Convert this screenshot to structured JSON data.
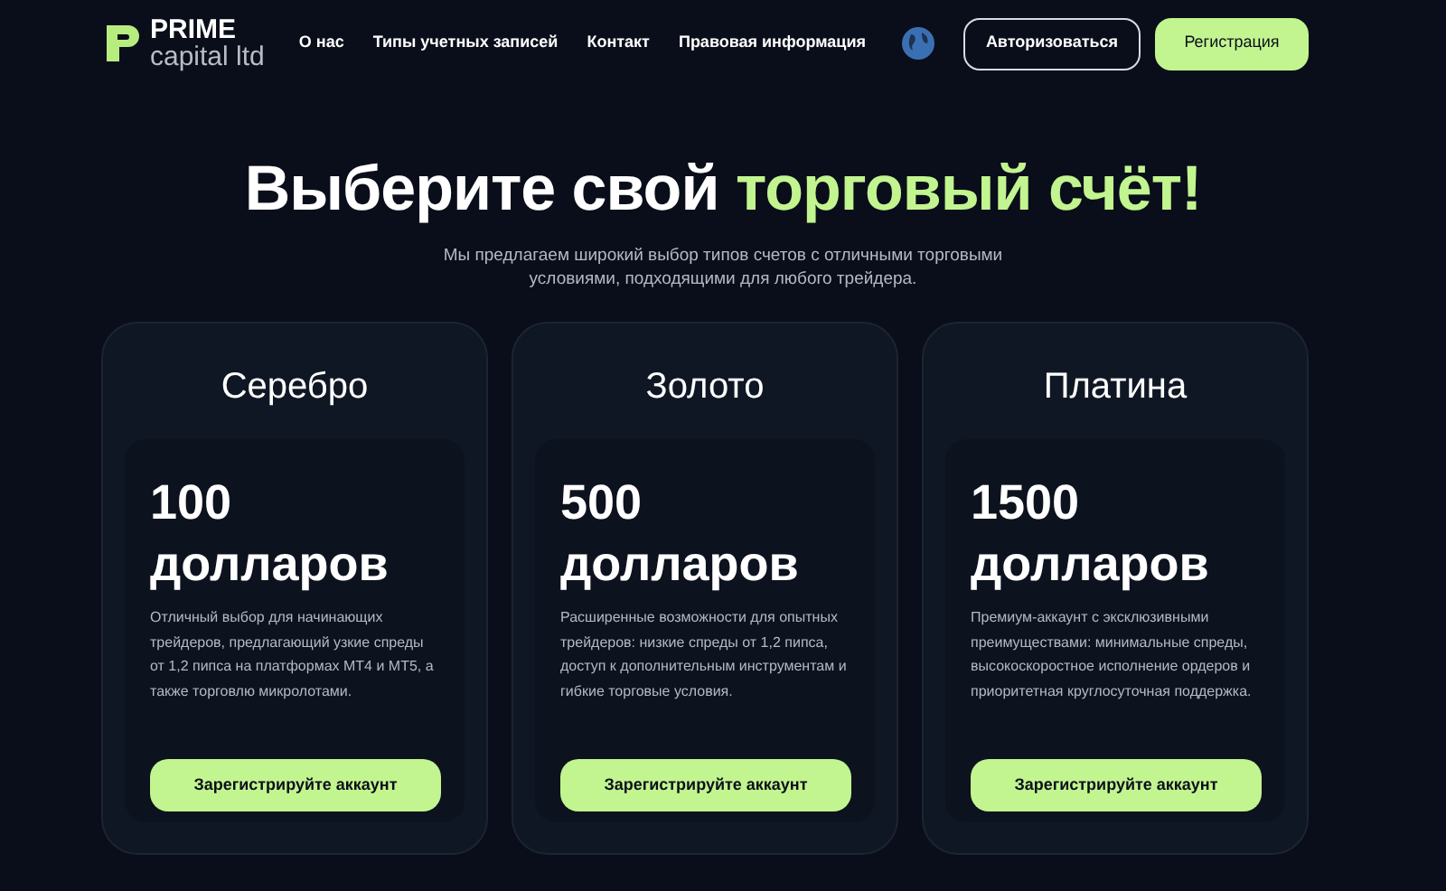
{
  "header": {
    "logo": {
      "name": "PRIME",
      "subtitle": "capital ltd"
    },
    "nav": [
      {
        "label": "О нас"
      },
      {
        "label": "Типы учетных записей"
      },
      {
        "label": "Контакт"
      },
      {
        "label": "Правовая информация"
      }
    ],
    "login_button": "Авторизоваться",
    "register_button": "Регистрация"
  },
  "hero": {
    "title": "Выберите свой",
    "title_accent": "торговый счёт!",
    "subtitle": "Мы предлагаем широкий выбор типов счетов с отличными торговыми условиями, подходящими для любого трейдера."
  },
  "plans": [
    {
      "name": "Серебро",
      "amount": "100",
      "currency": "долларов",
      "description": "Отличный выбор для начинающих трейдеров, предлагающий узкие спреды от 1,2 пипса на платформах MT4 и MT5, а также торговлю микролотами.",
      "button": "Зарегистрируйте аккаунт"
    },
    {
      "name": "Золото",
      "amount": "500",
      "currency": "долларов",
      "description": "Расширенные возможности для опытных трейдеров: низкие спреды от 1,2 пипса, доступ к дополнительным инструментам и гибкие торговые условия.",
      "button": "Зарегистрируйте аккаунт"
    },
    {
      "name": "Платина",
      "amount": "1500",
      "currency": "долларов",
      "description": "Премиум-аккаунт с эксклюзивными преимуществами: минимальные спреды, высокоскоростное исполнение ордеров и приоритетная круглосуточная поддержка.",
      "button": "Зарегистрируйте аккаунт"
    }
  ]
}
